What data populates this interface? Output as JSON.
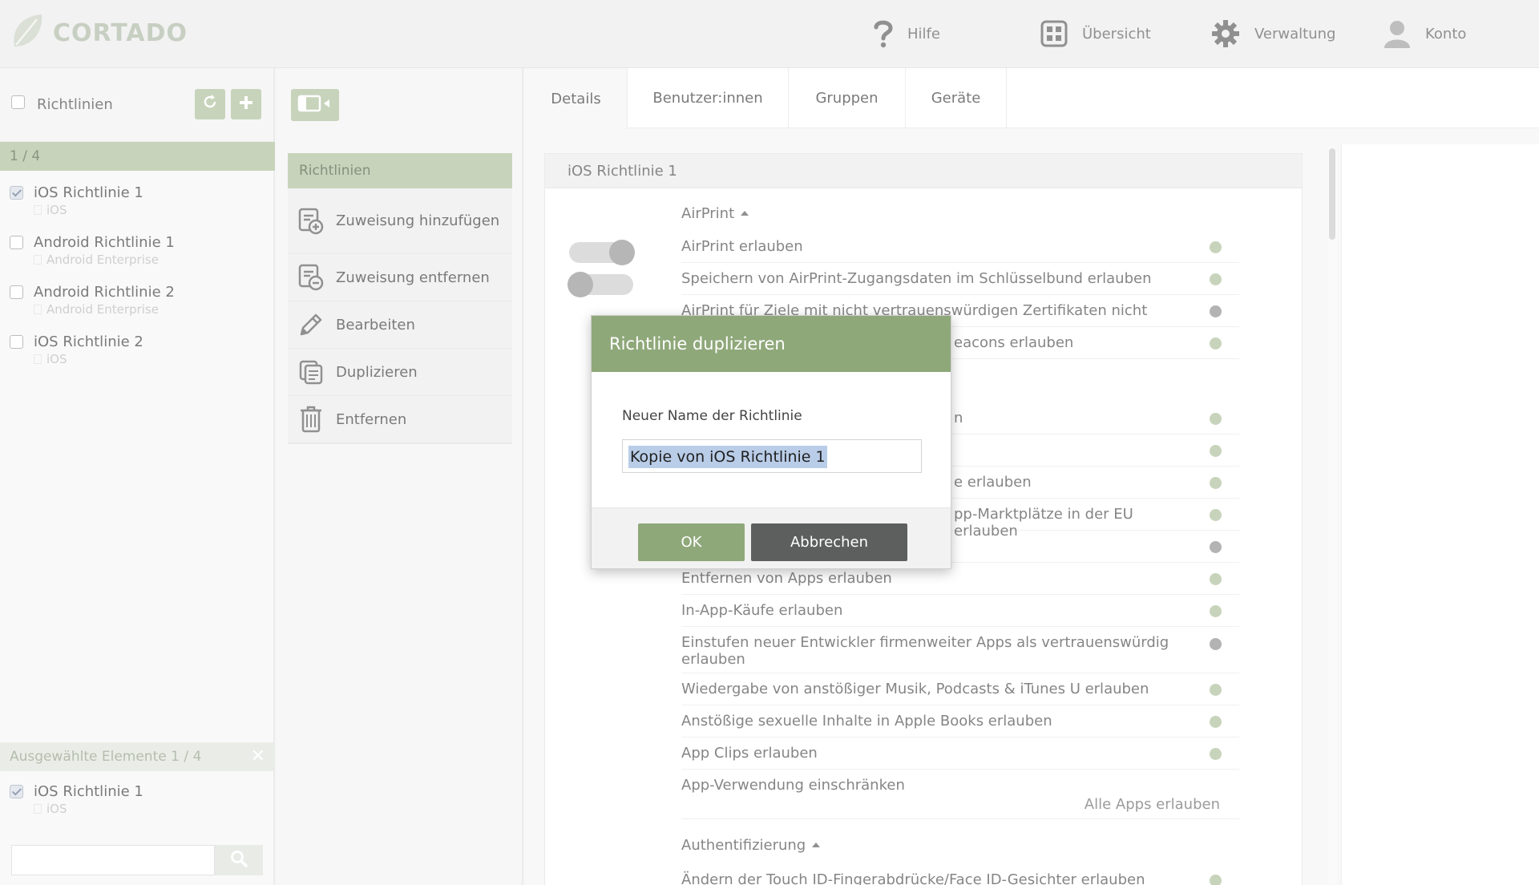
{
  "app": {
    "logo_text": "CORTADO"
  },
  "nav": [
    {
      "label": "Hilfe",
      "icon": "help-icon"
    },
    {
      "label": "Übersicht",
      "icon": "grid-icon"
    },
    {
      "label": "Verwaltung",
      "icon": "gear-icon"
    },
    {
      "label": "Konto",
      "icon": "user-icon"
    }
  ],
  "list": {
    "header_label": "Richtlinien",
    "counter": "1 / 4",
    "items": [
      {
        "title": "iOS Richtlinie 1",
        "sub": "iOS",
        "checked": true
      },
      {
        "title": "Android Richtlinie 1",
        "sub": "Android Enterprise",
        "checked": false
      },
      {
        "title": "Android Richtlinie 2",
        "sub": "Android Enterprise",
        "checked": false
      },
      {
        "title": "iOS Richtlinie 2",
        "sub": "iOS",
        "checked": false
      }
    ],
    "selected_label": "Ausgewählte Elemente 1 / 4",
    "selected_items": [
      {
        "title": "iOS Richtlinie 1",
        "sub": "iOS"
      }
    ],
    "search_value": ""
  },
  "actions": {
    "header": "Richtlinien",
    "items": [
      {
        "label": "Zuweisung hinzufügen"
      },
      {
        "label": "Zuweisung entfernen"
      },
      {
        "label": "Bearbeiten"
      },
      {
        "label": "Duplizieren"
      },
      {
        "label": "Entfernen"
      }
    ]
  },
  "details": {
    "tabs": [
      "Details",
      "Benutzer:innen",
      "Gruppen",
      "Geräte"
    ],
    "card_title": "iOS Richtlinie 1",
    "section1": "AirPrint",
    "rows1": [
      {
        "text": "AirPrint erlauben",
        "status": "green"
      },
      {
        "text": "Speichern von AirPrint-Zugangsdaten im Schlüsselbund erlauben",
        "status": "green"
      },
      {
        "text": "AirPrint für Ziele mit nicht vertrauenswürdigen Zertifikaten nicht erlauben",
        "status": "grey"
      },
      {
        "text": "eacons erlauben",
        "status": "green"
      }
    ],
    "rows2": [
      {
        "text": "n",
        "status": "green"
      },
      {
        "text": "",
        "status": "green"
      },
      {
        "text": "e erlauben",
        "status": "green"
      },
      {
        "text": "pp-Marktplätze in der EU erlauben",
        "status": "green"
      },
      {
        "text": "",
        "status": "grey"
      },
      {
        "text": "Entfernen von Apps erlauben",
        "status": "green"
      },
      {
        "text": "In-App-Käufe erlauben",
        "status": "green"
      },
      {
        "text": "Einstufen neuer Entwickler firmenweiter Apps als vertrauenswürdig erlauben",
        "status": "grey"
      },
      {
        "text": "Wiedergabe von anstößiger Musik, Podcasts & iTunes U erlauben",
        "status": "green"
      },
      {
        "text": "Anstößige sexuelle Inhalte in Apple Books erlauben",
        "status": "green"
      },
      {
        "text": "App Clips erlauben",
        "status": "green"
      }
    ],
    "app_usage_label": "App-Verwendung einschränken",
    "app_usage_value": "Alle Apps erlauben",
    "section2": "Authentifizierung",
    "rows3": [
      {
        "text": "Ändern der Touch ID-Fingerabdrücke/Face ID-Gesichter erlauben",
        "status": "green"
      }
    ]
  },
  "dialog": {
    "title": "Richtlinie duplizieren",
    "field_label": "Neuer Name der Richtlinie",
    "field_value": "Kopie von iOS Richtlinie 1",
    "ok_label": "OK",
    "cancel_label": "Abbrechen"
  },
  "colors": {
    "accent_green": "#a9bd97",
    "dialog_green": "#8fa87a",
    "status_green": "#a9bd97",
    "status_grey": "#8a8a8a",
    "cancel_dark": "#5d5f5e"
  }
}
